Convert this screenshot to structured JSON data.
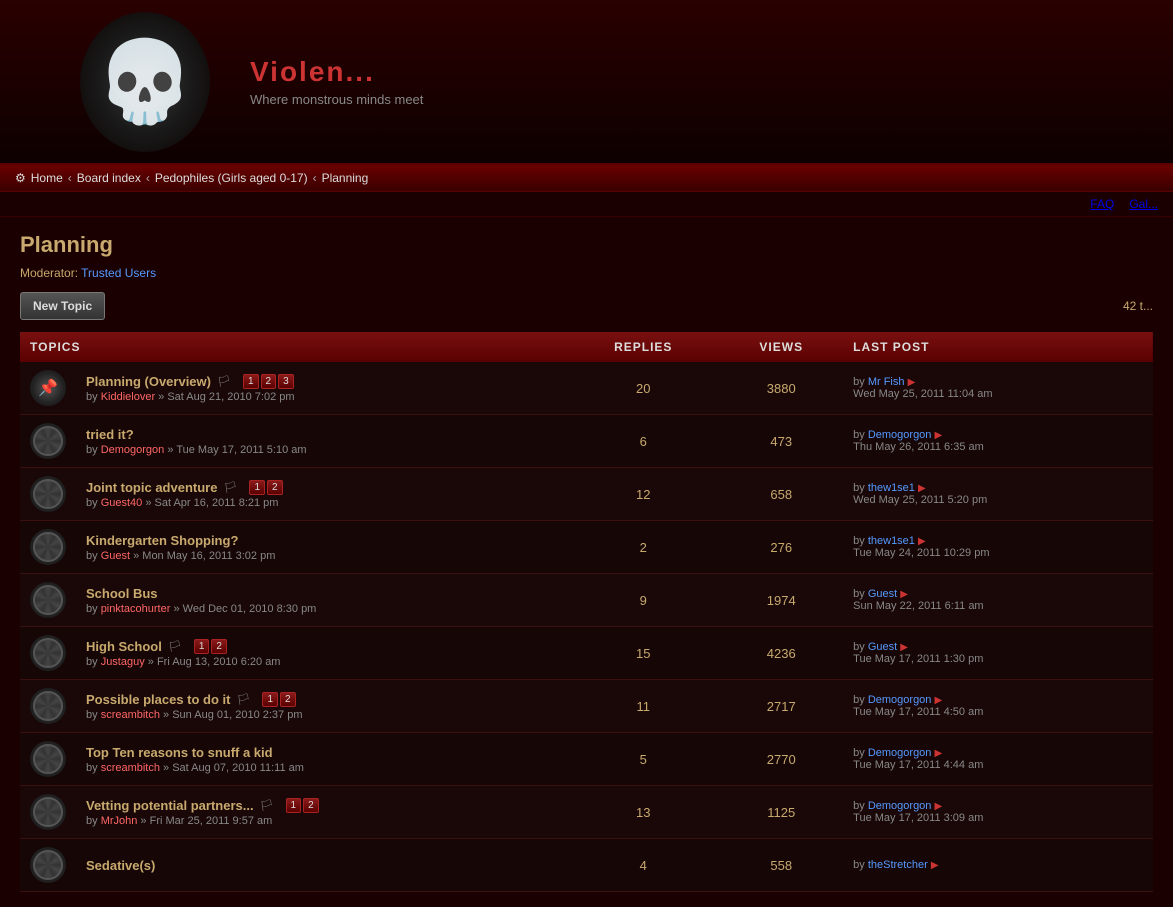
{
  "header": {
    "title": "Violen...",
    "subtitle": "Where monstrous minds meet"
  },
  "breadcrumb": {
    "home": "Home",
    "board_index": "Board index",
    "category": "Pedophiles (Girls aged 0-17)",
    "current": "Planning"
  },
  "topnav": {
    "faq": "FAQ",
    "gallery": "Gal..."
  },
  "page": {
    "title": "Planning",
    "moderator_label": "Moderator:",
    "moderator_user": "Trusted Users",
    "page_count": "42 t..."
  },
  "toolbar": {
    "new_topic": "New Topic"
  },
  "table": {
    "headers": {
      "topics": "TOPICS",
      "replies": "REPLIES",
      "views": "VIEWS",
      "last_post": "LAST POST"
    },
    "rows": [
      {
        "id": 1,
        "pinned": true,
        "title": "Planning (Overview)",
        "by": "by",
        "author": "Kiddielover",
        "date": "Sat Aug 21, 2010 7:02 pm",
        "replies": 20,
        "views": 3880,
        "last_post_by": "Mr Fish",
        "last_post_date": "Wed May 25, 2011 11:04 am",
        "pages": [
          "1",
          "2",
          "3"
        ],
        "flag": true
      },
      {
        "id": 2,
        "pinned": false,
        "title": "tried it?",
        "by": "by",
        "author": "Demogorgon",
        "date": "Tue May 17, 2011 5:10 am",
        "replies": 6,
        "views": 473,
        "last_post_by": "Demogorgon",
        "last_post_date": "Thu May 26, 2011 6:35 am",
        "pages": [],
        "flag": false
      },
      {
        "id": 3,
        "pinned": false,
        "title": "Joint topic adventure",
        "by": "by",
        "author": "Guest40",
        "date": "Sat Apr 16, 2011 8:21 pm",
        "replies": 12,
        "views": 658,
        "last_post_by": "thew1se1",
        "last_post_date": "Wed May 25, 2011 5:20 pm",
        "pages": [
          "1",
          "2"
        ],
        "flag": true
      },
      {
        "id": 4,
        "pinned": false,
        "title": "Kindergarten Shopping?",
        "by": "by",
        "author": "Guest",
        "date": "Mon May 16, 2011 3:02 pm",
        "replies": 2,
        "views": 276,
        "last_post_by": "thew1se1",
        "last_post_date": "Tue May 24, 2011 10:29 pm",
        "pages": [],
        "flag": false
      },
      {
        "id": 5,
        "pinned": false,
        "title": "School Bus",
        "by": "by",
        "author": "pinktacohurter",
        "date": "Wed Dec 01, 2010 8:30 pm",
        "replies": 9,
        "views": 1974,
        "last_post_by": "Guest",
        "last_post_date": "Sun May 22, 2011 6:11 am",
        "pages": [],
        "flag": false
      },
      {
        "id": 6,
        "pinned": false,
        "title": "High School",
        "by": "by",
        "author": "Justaguy",
        "date": "Fri Aug 13, 2010 6:20 am",
        "replies": 15,
        "views": 4236,
        "last_post_by": "Guest",
        "last_post_date": "Tue May 17, 2011 1:30 pm",
        "pages": [
          "1",
          "2"
        ],
        "flag": true
      },
      {
        "id": 7,
        "pinned": false,
        "title": "Possible places to do it",
        "by": "by",
        "author": "screambitch",
        "date": "Sun Aug 01, 2010 2:37 pm",
        "replies": 11,
        "views": 2717,
        "last_post_by": "Demogorgon",
        "last_post_date": "Tue May 17, 2011 4:50 am",
        "pages": [
          "1",
          "2"
        ],
        "flag": true
      },
      {
        "id": 8,
        "pinned": false,
        "title": "Top Ten reasons to snuff a kid",
        "by": "by",
        "author": "screambitch",
        "date": "Sat Aug 07, 2010 11:11 am",
        "replies": 5,
        "views": 2770,
        "last_post_by": "Demogorgon",
        "last_post_date": "Tue May 17, 2011 4:44 am",
        "pages": [],
        "flag": false
      },
      {
        "id": 9,
        "pinned": false,
        "title": "Vetting potential partners...",
        "by": "by",
        "author": "MrJohn",
        "date": "Fri Mar 25, 2011 9:57 am",
        "replies": 13,
        "views": 1125,
        "last_post_by": "Demogorgon",
        "last_post_date": "Tue May 17, 2011 3:09 am",
        "pages": [
          "1",
          "2"
        ],
        "flag": true
      },
      {
        "id": 10,
        "pinned": false,
        "title": "Sedative(s)",
        "by": "by",
        "author": "",
        "date": "",
        "replies": 4,
        "views": 558,
        "last_post_by": "theStretcher",
        "last_post_date": "",
        "pages": [],
        "flag": false
      }
    ]
  }
}
